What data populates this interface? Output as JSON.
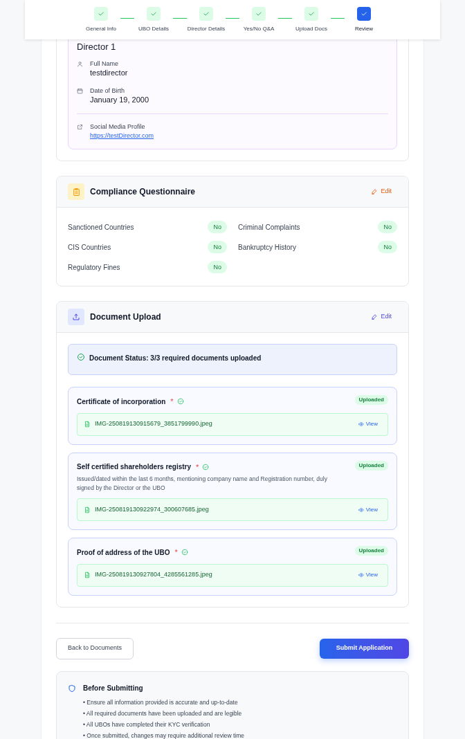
{
  "steps": [
    {
      "label": "General Info",
      "selected": false
    },
    {
      "label": "UBO Details",
      "selected": false
    },
    {
      "label": "Director Details",
      "selected": false
    },
    {
      "label": "Yes/No Q&A",
      "selected": false
    },
    {
      "label": "Upload Docs",
      "selected": false
    },
    {
      "label": "Review",
      "selected": true
    }
  ],
  "director": {
    "title": "Director 1",
    "fields": [
      {
        "kind": "person",
        "label": "Full Name",
        "value": "testdirector"
      },
      {
        "kind": "calendar",
        "label": "Date of Birth",
        "value": "January 19, 2000"
      }
    ],
    "social": {
      "label": "Social Media Profile",
      "link": "https://testDirector.com"
    }
  },
  "compliance": {
    "title": "Compliance Questionnaire",
    "edit": "Edit",
    "items": [
      {
        "label": "Sanctioned Countries",
        "answer": "No"
      },
      {
        "label": "Criminal Complaints",
        "answer": "No"
      },
      {
        "label": "CIS Countries",
        "answer": "No"
      },
      {
        "label": "Bankruptcy History",
        "answer": "No"
      },
      {
        "label": "Regulatory Fines",
        "answer": "No"
      }
    ]
  },
  "documents": {
    "title": "Document Upload",
    "edit": "Edit",
    "status": "Document Status: 3/3 required documents uploaded",
    "items": [
      {
        "title": "Certificate of incorporation",
        "required_mark": "*",
        "badge": "Uploaded",
        "file": "IMG-250819130915679_3851799990.jpeg",
        "view": "View"
      },
      {
        "title": "Self certified shareholders registry",
        "required_mark": "*",
        "badge": "Uploaded",
        "description": "Issued/dated within the last 6 months, mentioning company name and Registration number, duly signed by the Director or the UBO",
        "file": "IMG-250819130922974_300607685.jpeg",
        "view": "View"
      },
      {
        "title": "Proof of address of the UBO",
        "required_mark": "*",
        "badge": "Uploaded",
        "file": "IMG-250819130927804_4285561285.jpeg",
        "view": "View"
      }
    ]
  },
  "actions": {
    "back": "Back to Documents",
    "submit": "Submit Application"
  },
  "notice": {
    "title": "Before Submitting",
    "items": [
      "• Ensure all information provided is accurate and up-to-date",
      "• All required documents have been uploaded and are legible",
      "• All UBOs have completed their KYC verification",
      "• Once submitted, changes may require additional review time"
    ]
  }
}
